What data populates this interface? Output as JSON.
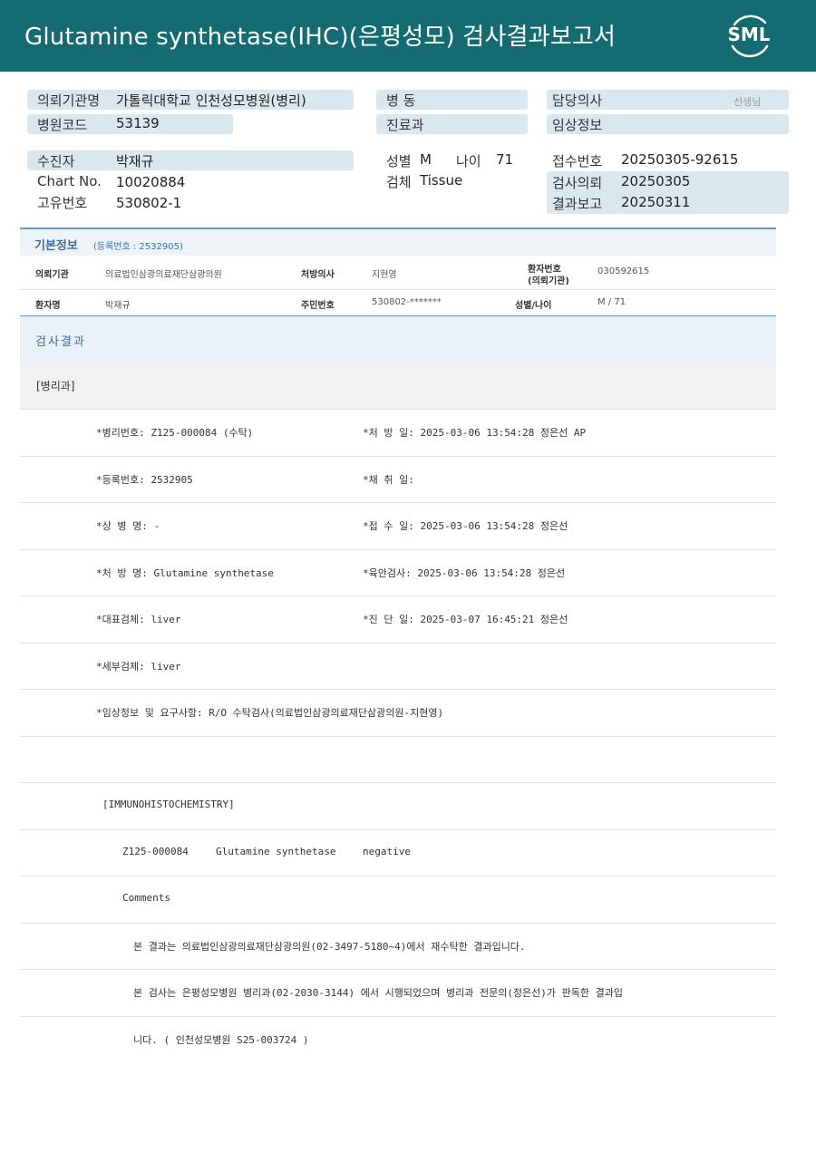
{
  "header": {
    "title": "Glutamine  synthetase(IHC)(은평성모) 검사결과보고서",
    "logo_text": "SML",
    "color": "#156b72"
  },
  "top": {
    "institution_label": "의뢰기관명",
    "institution_value": "가톨릭대학교 인천성모병원(병리)",
    "hospital_code_label": "병원코드",
    "hospital_code_value": "53139",
    "ward_label": "병   동",
    "dept_label": "진료과",
    "doctor_label": "담당의사",
    "doctor_suffix": "선생님",
    "clinical_label": "임상정보",
    "patient_label": "수진자",
    "patient_value": "박재규",
    "chart_label": "Chart No.",
    "chart_value": "10020884",
    "unique_label": "고유번호",
    "unique_value": "530802-1",
    "sex_label": "성별",
    "sex_value": "M",
    "age_label": "나이",
    "age_value": "71",
    "specimen_label": "검체",
    "specimen_value": "Tissue",
    "receipt_label": "접수번호",
    "receipt_value": "20250305-92615",
    "request_label": "검사의뢰",
    "request_value": "20250305",
    "report_label": "결과보고",
    "report_value": "20250311"
  },
  "basic": {
    "title": "기본정보",
    "subtitle": "(등록번호 : 2532905)",
    "row1": {
      "k1": "의뢰기관",
      "v1": "의료법인삼광의료재단삼광의원",
      "k2": "처방의사",
      "v2": "지현영",
      "k3a": "환자번호",
      "k3b": "(의뢰기관)",
      "v3": "030592615"
    },
    "row2": {
      "k1": "환자명",
      "v1": "박재규",
      "k2": "주민번호",
      "v2": "530802-*******",
      "k3": "성별/나이",
      "v3": "M / 71"
    }
  },
  "result": {
    "title": "검사결과",
    "dept": "[병리과]",
    "lines": [
      {
        "left": "*병리번호: Z125-000084 (수탁)",
        "right": "*처 방 일: 2025-03-06 13:54:28  정은선 AP"
      },
      {
        "left": "*등록번호: 2532905",
        "right": "*채 취 일:"
      },
      {
        "left": "*상 병 명: -",
        "right": "*접 수 일: 2025-03-06 13:54:28  정은선"
      },
      {
        "left": "*처 방 명: Glutamine synthetase",
        "right": "*육안검사: 2025-03-06 13:54:28  정은선"
      },
      {
        "left": "*대표검체: liver",
        "right": "*진 단 일: 2025-03-07 16:45:21  정은선"
      },
      {
        "left": "*세부검체: liver",
        "right": ""
      },
      {
        "left": "*임상정보 및 요구사항: R/O 수탁검사(의료법인삼광의료재단삼광의원-지현영)",
        "right": ""
      },
      {
        "left": "",
        "right": ""
      }
    ],
    "ihc_header": "[IMMUNOHISTOCHEMISTRY]",
    "ihc_case": "Z125-000084",
    "ihc_stain": "Glutamine synthetase",
    "ihc_result": "negative",
    "comments_label": "Comments",
    "comment1": "본 결과는 의료법인삼광의료재단삼광의원(02-3497-5180~4)에서 재수탁한 결과입니다.",
    "comment2": "본 검사는 은평성모병원 병리과(02-2030-3144) 에서 시행되었으며 병리과 전문의(정은선)가 판독한 결과입",
    "comment3": "니다. ( 인천성모병원 S25-003724 )"
  }
}
